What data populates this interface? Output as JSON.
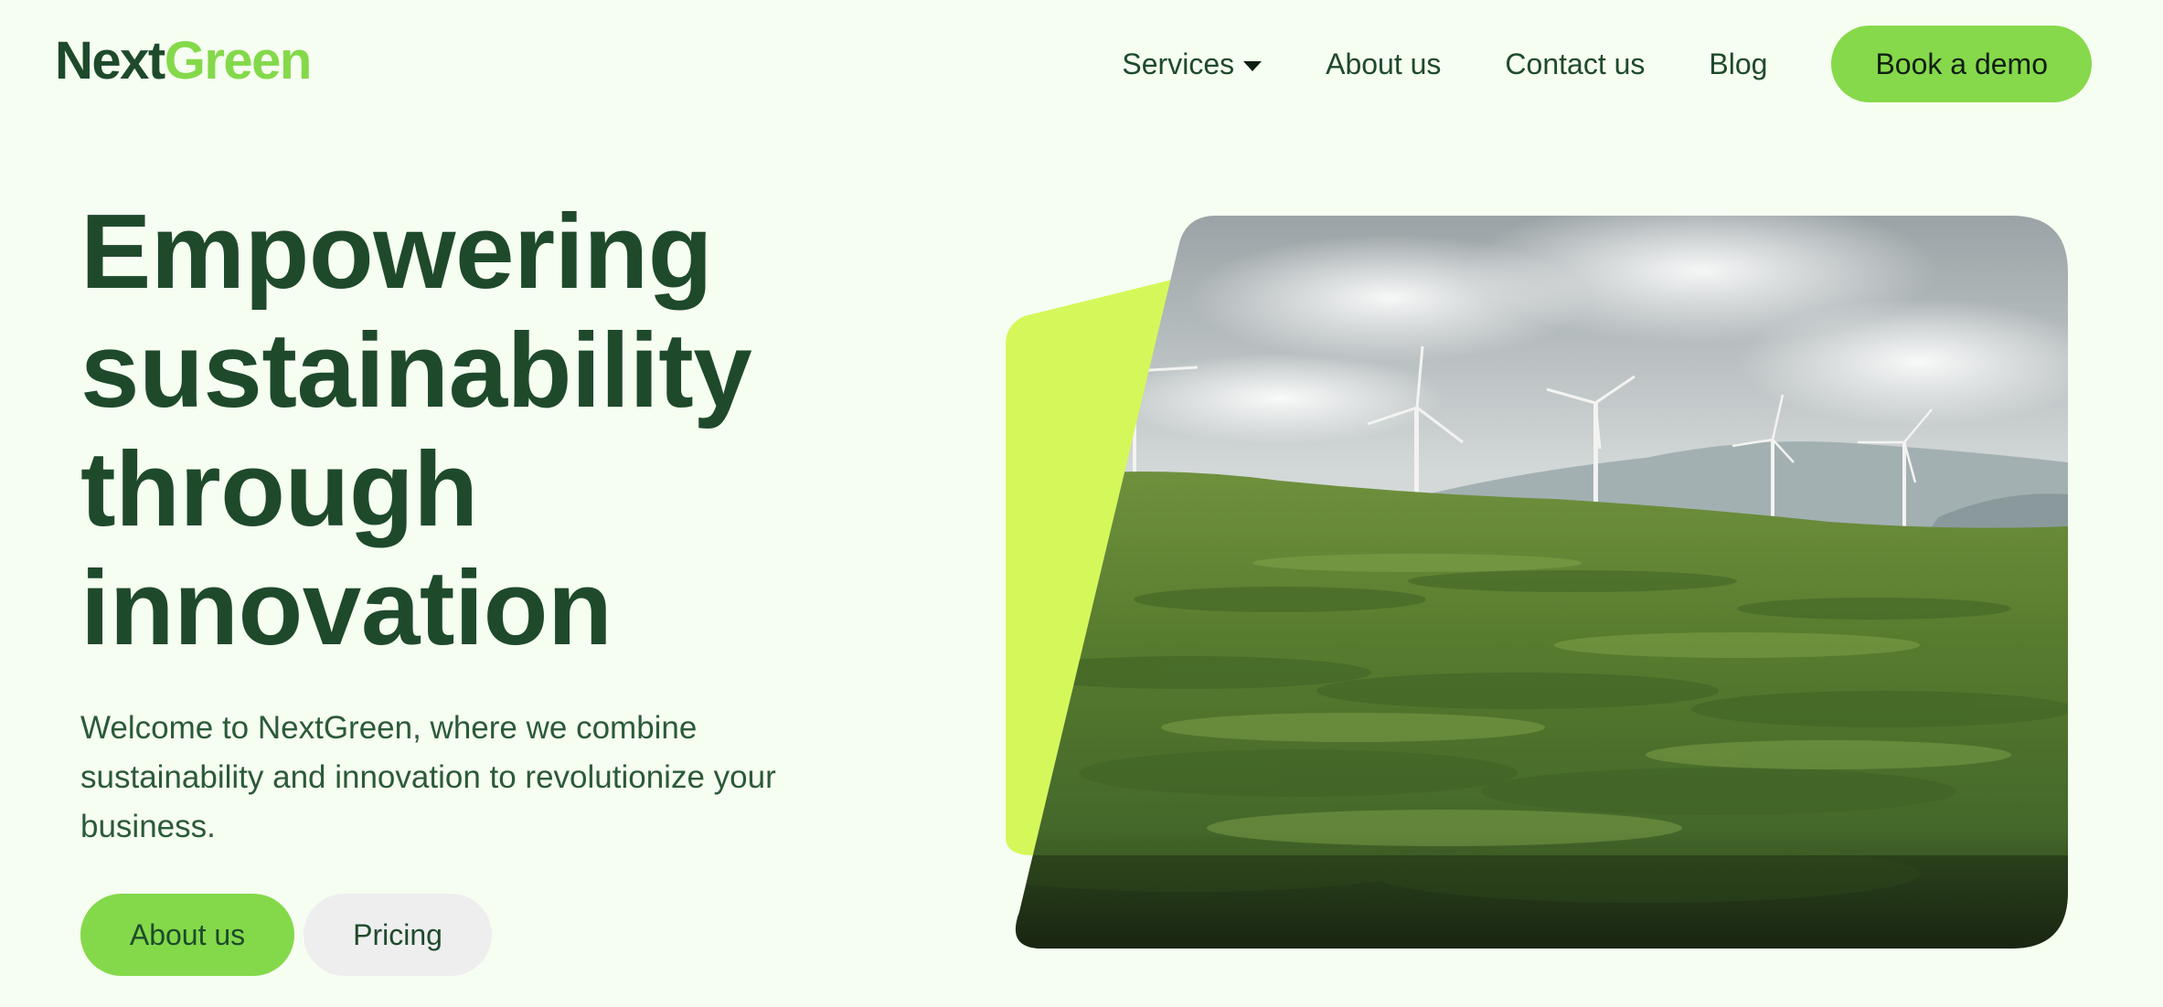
{
  "header": {
    "logo_part1": "Next",
    "logo_part2": "Green",
    "nav": {
      "services": "Services",
      "about": "About us",
      "contact": "Contact us",
      "blog": "Blog"
    },
    "cta": "Book a demo"
  },
  "hero": {
    "title_lines": [
      "Empowering",
      "sustainability",
      "through",
      "innovation"
    ],
    "subtitle": "Welcome to NextGreen, where we combine sustainability and innovation to revolutionize your business.",
    "buttons": {
      "primary": "About us",
      "secondary": "Pricing"
    },
    "image_icon": "wind-turbines-landscape"
  },
  "colors": {
    "background": "#f6fdf1",
    "brand_dark": "#1e4a2b",
    "brand_green": "#84d94a",
    "accent_lime": "#d4f85a",
    "secondary_button": "#eeeeef"
  }
}
